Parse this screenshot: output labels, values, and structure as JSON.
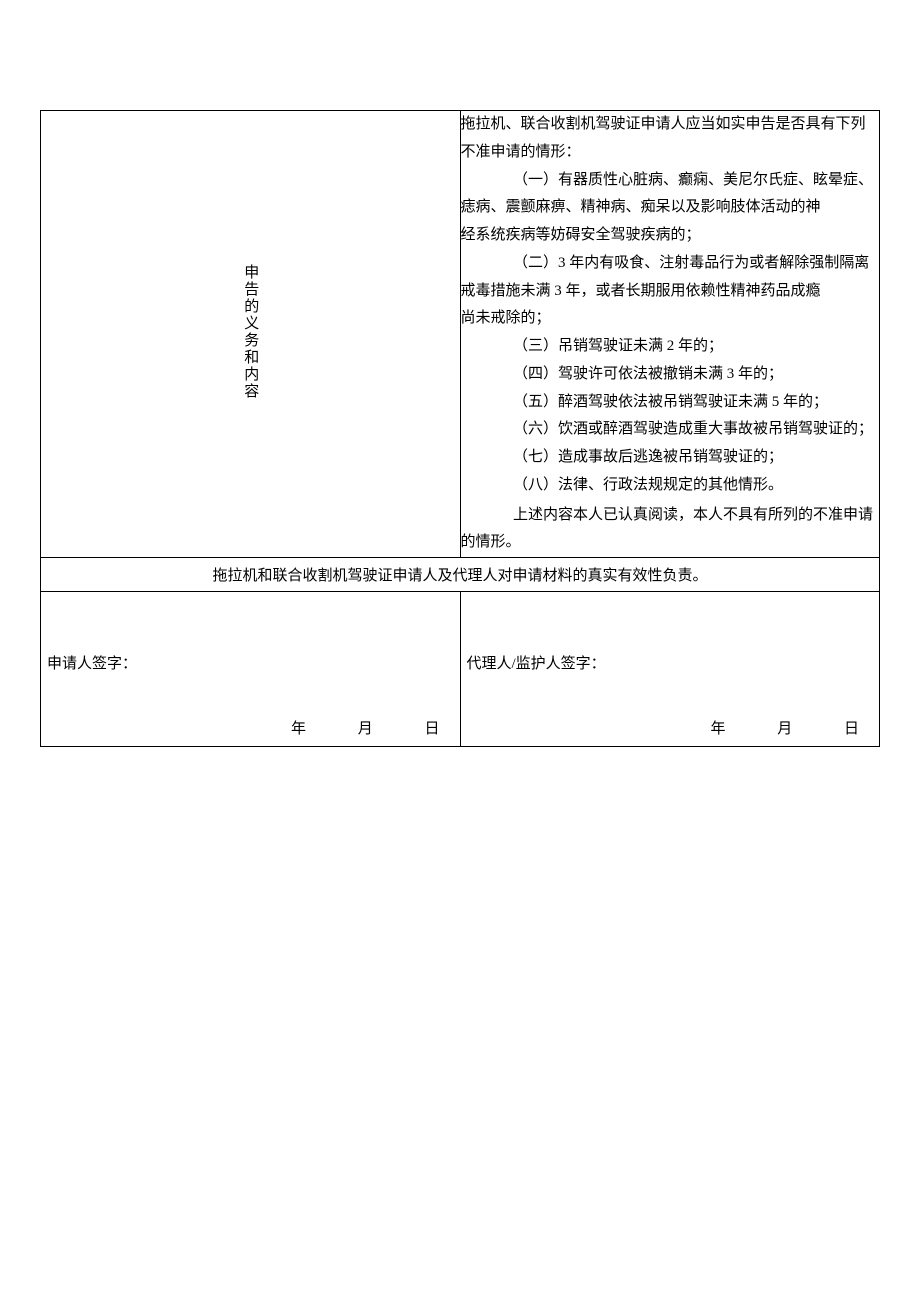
{
  "declaration": {
    "label": "申告的义务和内容",
    "intro": "拖拉机、联合收割机驾驶证申请人应当如实申告是否具有下列不准申请的情形：",
    "item1": "（一）有器质性心脏病、癫痫、美尼尔氏症、眩晕症、痣病、震颤麻痹、精神病、痴呆以及影响肢体活动的神",
    "item1_cont": "经系统疾病等妨碍安全驾驶疾病的；",
    "item2": "（二）3 年内有吸食、注射毒品行为或者解除强制隔离戒毒措施未满 3 年，或者长期服用依赖性精神药品成瘾",
    "item2_cont": "尚未戒除的；",
    "item3": "（三）吊销驾驶证未满 2 年的；",
    "item4": "（四）驾驶许可依法被撤销未满 3 年的；",
    "item5": "（五）醉酒驾驶依法被吊销驾驶证未满 5 年的；",
    "item6": "（六）饮酒或醉酒驾驶造成重大事故被吊销驾驶证的；",
    "item7": "（七）造成事故后逃逸被吊销驾驶证的；",
    "item8": "（八）法律、行政法规规定的其他情形。",
    "confirm": "上述内容本人已认真阅读，本人不具有所列的不准申请的情形。"
  },
  "responsibility": "拖拉机和联合收割机驾驶证申请人及代理人对申请材料的真实有效性负责。",
  "signature": {
    "applicant_label": "申请人签字：",
    "agent_label": "代理人/监护人签字：",
    "year": "年",
    "month": "月",
    "day": "日"
  }
}
